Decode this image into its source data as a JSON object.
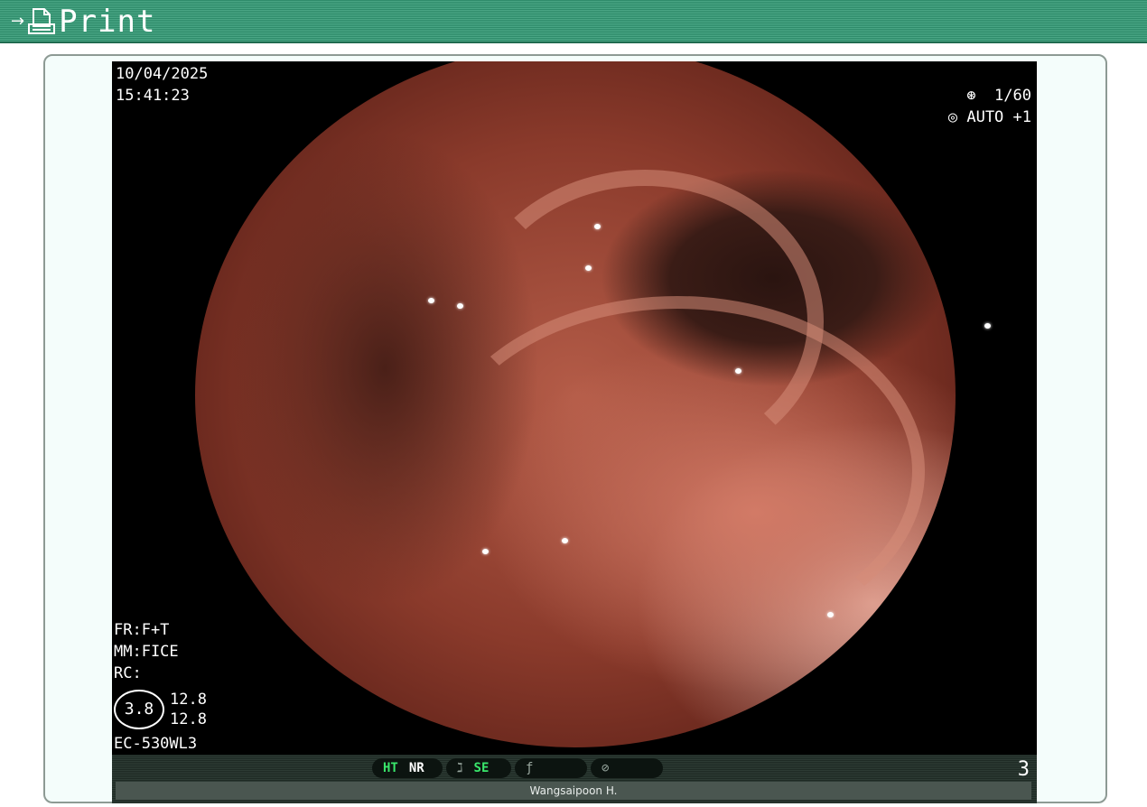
{
  "header": {
    "print_label": "Print",
    "arrow_icon": "arrow-right-icon",
    "printer_icon": "printer-document-icon",
    "bg_color": "#2e8b6a"
  },
  "endoscope": {
    "date": "10/04/2025",
    "time": "15:41:23",
    "shutter": "1/60",
    "iris": "AUTO +1",
    "fr": "FR:F+T",
    "mm": "MM:FICE",
    "rc": "RC:",
    "zoom": "3.8",
    "zoom_val_1": "12.8",
    "zoom_val_2": "12.8",
    "scope_model": "EC-530WL3",
    "status": {
      "ht": "HT",
      "nr": "NR",
      "se": "SE",
      "frame_number": "3",
      "operator": "Wangsaipoon H."
    }
  }
}
